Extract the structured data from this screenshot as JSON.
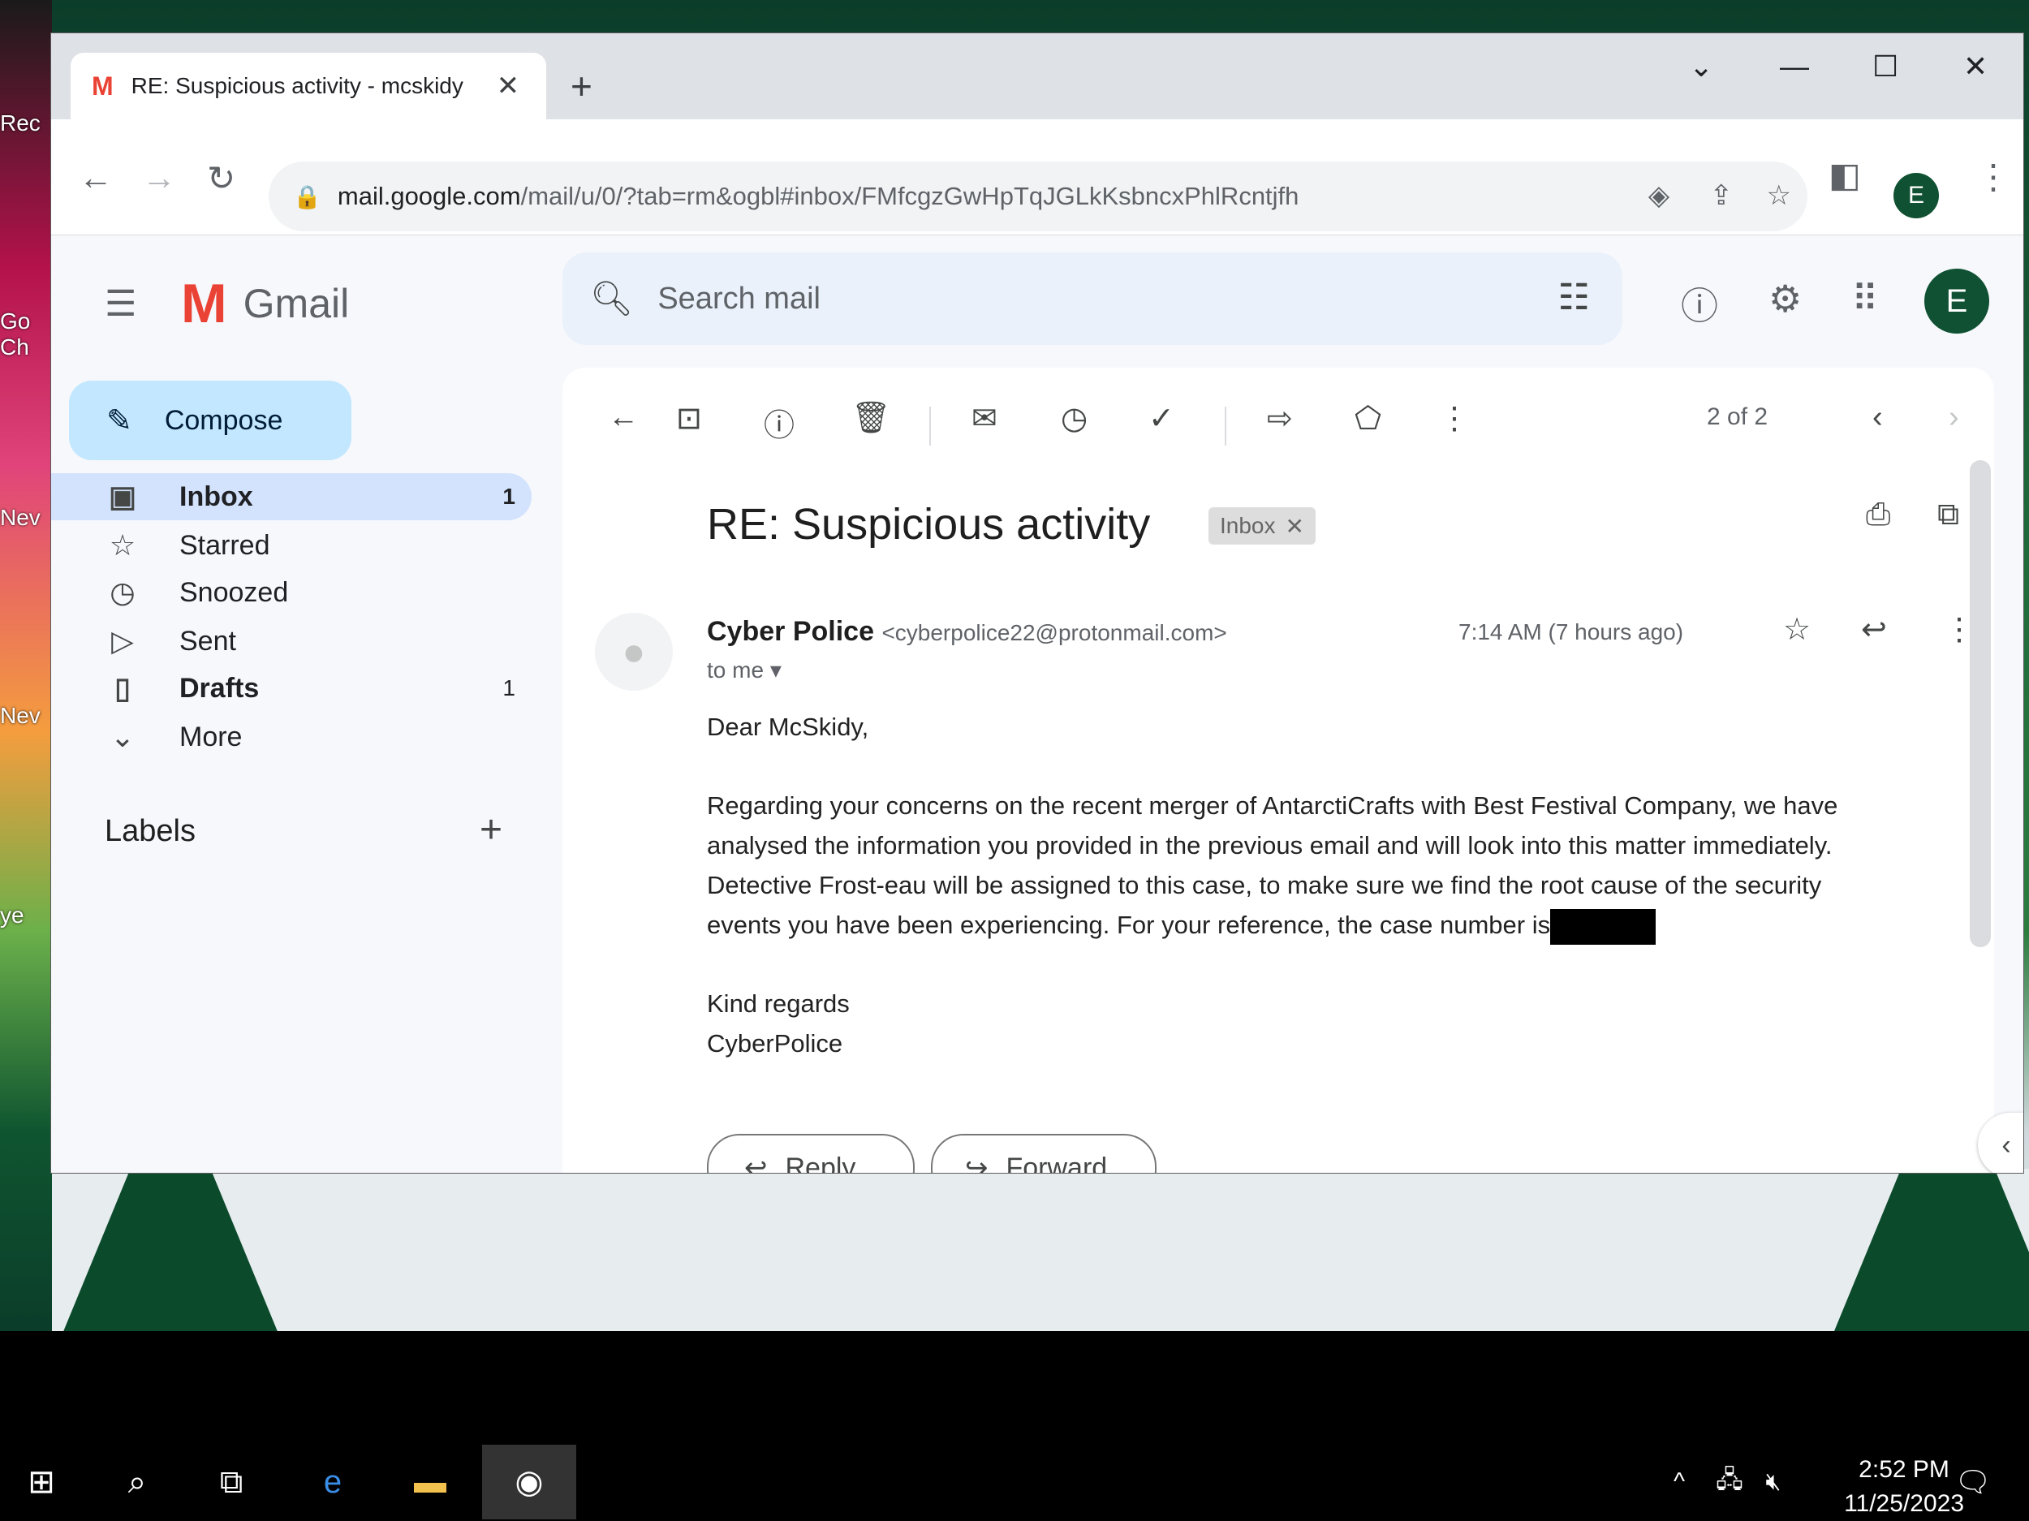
{
  "desktop": {
    "icon_labels": [
      "Rec",
      "Go",
      "Ch",
      "Nev",
      "Nev",
      "ye"
    ]
  },
  "browser": {
    "tab_title": "RE: Suspicious activity - mcskidy",
    "url_host": "mail.google.com",
    "url_path": "/mail/u/0/?tab=rm&ogbl#inbox/FMfcgzGwHpTqJGLkKsbncxPhlRcntjfh",
    "profile_initial": "E"
  },
  "gmail": {
    "brand": "Gmail",
    "search_placeholder": "Search mail",
    "profile_initial": "E",
    "compose_label": "Compose",
    "nav": [
      {
        "label": "Inbox",
        "count": "1"
      },
      {
        "label": "Starred",
        "count": ""
      },
      {
        "label": "Snoozed",
        "count": ""
      },
      {
        "label": "Sent",
        "count": ""
      },
      {
        "label": "Drafts",
        "count": "1"
      },
      {
        "label": "More",
        "count": ""
      }
    ],
    "labels_heading": "Labels"
  },
  "message": {
    "pager": "2 of 2",
    "subject": "RE: Suspicious activity",
    "chip": "Inbox",
    "sender_name": "Cyber Police",
    "sender_email": "<cyberpolice22@protonmail.com>",
    "to": "to me",
    "time": "7:14 AM (7 hours ago)",
    "greeting": "Dear McSkidy,",
    "paragraph": "Regarding your concerns on the recent merger of AntarctiCrafts with Best Festival Company, we have analysed the information you provided in the previous email and will look into this matter immediately. Detective Frost-eau will be assigned to this case, to make sure we find the root cause of the security events you have been experiencing. For your reference, the case number is",
    "signoff": "Kind regards",
    "signature": "CyberPolice",
    "reply_label": "Reply",
    "forward_label": "Forward"
  },
  "taskbar": {
    "time": "2:52 PM",
    "date": "11/25/2023"
  }
}
